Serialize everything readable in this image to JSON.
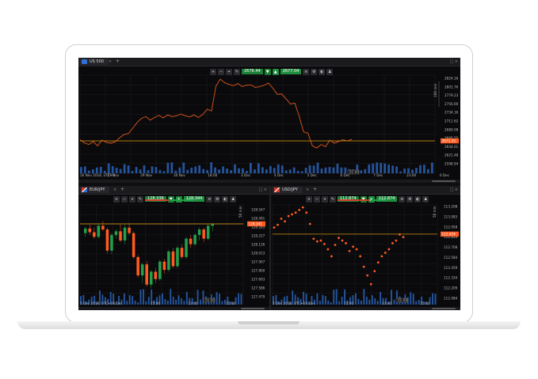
{
  "colors": {
    "accent_orange": "#ff5a1f",
    "line_orange": "#e0561c",
    "gold_line": "#c88a10",
    "green": "#22a04a",
    "sell_box": "#1b7f36",
    "buy_box": "#1e8e3e",
    "red": "#d23c2a"
  },
  "top_panel": {
    "tab_label": "US 500",
    "tab_close": "×",
    "tab_add": "+",
    "sell_price": "2676.44",
    "buy_price": "2677.04",
    "sell_marker": "▼",
    "buy_marker": "▲",
    "current_price": "2673.33",
    "window_controls": "□ ×",
    "y_ticks": [
      "2824.16",
      "2801.76",
      "2779.23",
      "2756.69",
      "2734.16",
      "2711.62",
      "2689.08",
      "2666.55",
      "2644.01",
      "2621.48",
      "2598.94"
    ],
    "x_ticks": [
      "26 Nov 2018, UTC+0",
      "27 Nov",
      "29 Nov",
      "30 Nov",
      "18:00",
      "3 Dec",
      "4 Dec",
      "5 Dec",
      "6 Dec",
      "7 Dec",
      "23:00",
      "6 Dec"
    ],
    "crosshair_tag": "01:00",
    "scale_tag": "100 min",
    "timeframe": "1h"
  },
  "left_panel": {
    "tab_label": "EUR/JPY",
    "tab_close": "×",
    "tab_add": "+",
    "sell_price": "128.336",
    "buy_price": "128.344",
    "sell_marker": "▼",
    "buy_marker": "▲",
    "current_price": "128.341",
    "window_controls": "□ ×",
    "y_ticks": [
      "128.547",
      "128.491",
      "128.285",
      "128.227",
      "128.126",
      "128.013",
      "127.907",
      "127.800",
      "127.693",
      "127.586",
      "127.479"
    ],
    "x_ticks": [
      "5 Dec 2018, UTC+0",
      "6 Dec",
      "15:00",
      "23:00",
      "15:00"
    ],
    "crosshair_tag": "01:00",
    "scale_tag": "50 min"
  },
  "right_panel": {
    "tab_label": "USD/JPY",
    "tab_close": "×",
    "tab_add": "+",
    "sell_price": "112.874",
    "buy_price": "112.874",
    "sell_marker": "▼",
    "buy_marker": "▲",
    "current_price": "112.874",
    "window_controls": "□ ×",
    "y_ticks": [
      "113.208",
      "113.083",
      "112.958",
      "112.833",
      "112.708",
      "112.584",
      "112.459",
      "112.334",
      "112.209",
      "112.084"
    ],
    "x_ticks": [
      "5 Dec 2018, UTC+0",
      "6 Dec",
      "15:00",
      "23:00",
      "15:00"
    ],
    "crosshair_tag": "01:00",
    "scale_tag": "50 min"
  },
  "toolbar_icons": [
    "zoom-in-icon",
    "zoom-out-icon",
    "crosshair-icon",
    "drawing-icon"
  ],
  "toolbar_icons_right": [
    "list-icon",
    "settings-icon",
    "chart-type-icon",
    "person-icon"
  ],
  "chart_data": [
    {
      "type": "line",
      "title": "US 500",
      "ylim": [
        2598.94,
        2824.16
      ],
      "series": [
        {
          "values": [
            2676,
            2669,
            2665,
            2672,
            2662,
            2675,
            2670,
            2668,
            2671,
            2680,
            2688,
            2690,
            2702,
            2715,
            2725,
            2729,
            2721,
            2727,
            2732,
            2726,
            2733,
            2729,
            2731,
            2735,
            2731,
            2728,
            2733,
            2727,
            2734,
            2746,
            2742,
            2799,
            2815,
            2807,
            2803,
            2800,
            2805,
            2798,
            2801,
            2802,
            2796,
            2798,
            2801,
            2806,
            2794,
            2780,
            2781,
            2770,
            2758,
            2760,
            2730,
            2694,
            2691,
            2662,
            2657,
            2665,
            2660,
            2675,
            2668,
            2672,
            2676,
            2673,
            2677
          ]
        }
      ],
      "reference_price": 2673.33
    },
    {
      "type": "candlestick",
      "title": "EUR/JPY",
      "ylim": [
        127.479,
        128.547
      ],
      "candles": [
        [
          128.24,
          128.31,
          128.2,
          128.29
        ],
        [
          128.29,
          128.33,
          128.22,
          128.25
        ],
        [
          128.25,
          128.3,
          128.18,
          128.2
        ],
        [
          128.2,
          128.34,
          128.18,
          128.32
        ],
        [
          128.32,
          128.37,
          128.26,
          128.28
        ],
        [
          128.28,
          128.3,
          128.02,
          128.05
        ],
        [
          128.05,
          128.24,
          128.01,
          128.22
        ],
        [
          128.22,
          128.28,
          128.18,
          128.26
        ],
        [
          128.26,
          128.34,
          128.14,
          128.16
        ],
        [
          128.16,
          128.33,
          128.12,
          128.3
        ],
        [
          128.3,
          128.35,
          128.22,
          128.24
        ],
        [
          128.24,
          128.26,
          127.96,
          127.98
        ],
        [
          127.98,
          128.0,
          127.76,
          127.78
        ],
        [
          127.78,
          127.92,
          127.7,
          127.9
        ],
        [
          127.9,
          127.94,
          127.66,
          127.68
        ],
        [
          127.68,
          127.84,
          127.64,
          127.82
        ],
        [
          127.82,
          127.86,
          127.7,
          127.74
        ],
        [
          127.74,
          127.95,
          127.72,
          127.93
        ],
        [
          127.93,
          127.96,
          127.8,
          127.84
        ],
        [
          127.84,
          128.06,
          127.82,
          128.04
        ],
        [
          128.04,
          128.08,
          127.86,
          127.88
        ],
        [
          127.88,
          128.1,
          127.86,
          128.08
        ],
        [
          128.08,
          128.12,
          127.96,
          127.98
        ],
        [
          127.98,
          128.2,
          127.96,
          128.18
        ],
        [
          128.18,
          128.22,
          128.08,
          128.12
        ],
        [
          128.12,
          128.24,
          128.1,
          128.22
        ],
        [
          128.22,
          128.3,
          128.16,
          128.28
        ],
        [
          128.28,
          128.3,
          128.14,
          128.18
        ],
        [
          128.18,
          128.34,
          128.16,
          128.32
        ],
        [
          128.32,
          128.35,
          128.26,
          128.34
        ]
      ],
      "reference_price": 128.341
    },
    {
      "type": "scatter",
      "title": "USD/JPY",
      "ylim": [
        112.084,
        113.208
      ],
      "series": [
        {
          "values": [
            112.95,
            112.98,
            113.05,
            113.02,
            113.08,
            113.1,
            113.12,
            113.15,
            113.18,
            113.12,
            112.99,
            112.82,
            112.79,
            112.8,
            112.76,
            112.7,
            112.62,
            112.75,
            112.83,
            112.8,
            112.77,
            112.68,
            112.73,
            112.7,
            112.62,
            112.5,
            112.4,
            112.3,
            112.45,
            112.55,
            112.62,
            112.66,
            112.7,
            112.77,
            112.8,
            112.87,
            112.84
          ]
        }
      ],
      "reference_price": 112.874
    }
  ]
}
